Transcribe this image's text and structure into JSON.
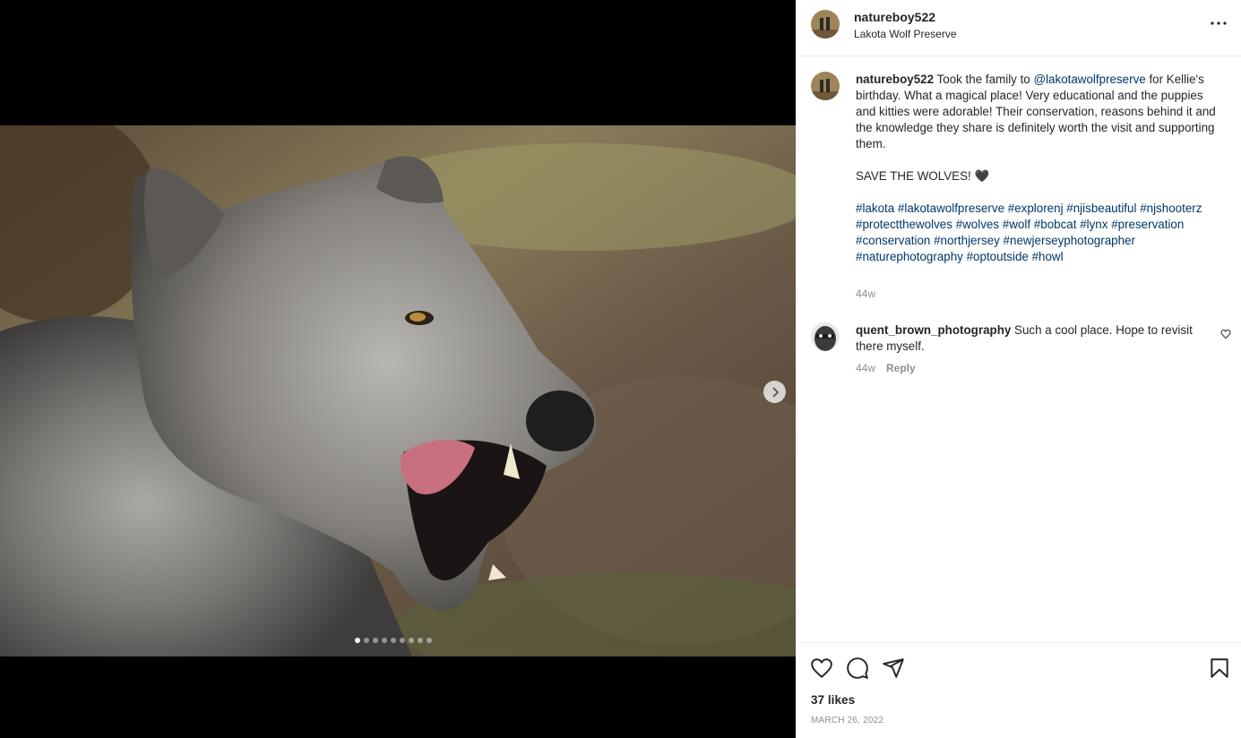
{
  "post": {
    "username": "natureboy522",
    "location": "Lakota Wolf Preserve",
    "more_icon": "more-horizontal-icon",
    "carousel": {
      "total_slides": 9,
      "active_index": 0,
      "next_icon": "chevron-right-icon"
    }
  },
  "caption": {
    "username": "natureboy522",
    "text_before_mention": " Took the family to ",
    "mention": "@lakotawolfpreserve",
    "text_after_mention": " for Kellie's birthday. What a magical place! Very educational and the puppies and kitties were adorable! Their conservation, reasons behind it and the knowledge they share is definitely worth the visit and supporting them.",
    "line2": "SAVE THE WOLVES! 🖤",
    "hashtags": [
      "#lakota",
      "#lakotawolfpreserve",
      "#explorenj",
      "#njisbeautiful",
      "#njshooterz",
      "#protectthewolves",
      "#wolves",
      "#wolf",
      "#bobcat",
      "#lynx",
      "#preservation",
      "#conservation",
      "#northjersey",
      "#newjerseyphotographer",
      "#naturephotography",
      "#optoutside",
      "#howl"
    ],
    "time": "44w"
  },
  "comments": [
    {
      "username": "quent_brown_photography",
      "text": " Such a cool place. Hope to revisit there myself.",
      "time": "44w",
      "reply_label": "Reply"
    }
  ],
  "actions": {
    "like_icon": "heart-icon",
    "comment_icon": "comment-icon",
    "share_icon": "share-icon",
    "save_icon": "bookmark-icon",
    "likes_text": "37 likes",
    "date": "MARCH 26, 2022"
  }
}
